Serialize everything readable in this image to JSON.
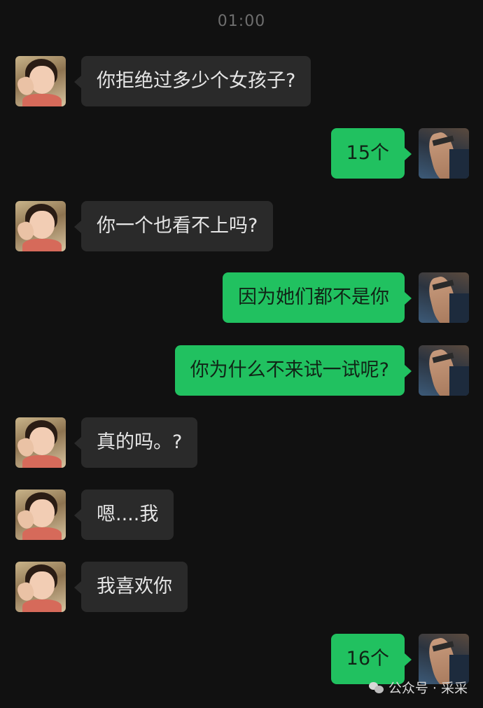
{
  "chat": {
    "timestamp": "01:00",
    "messages": [
      {
        "side": "left",
        "text": "你拒绝过多少个女孩子?"
      },
      {
        "side": "right",
        "text": "15个"
      },
      {
        "side": "left",
        "text": "你一个也看不上吗?"
      },
      {
        "side": "right",
        "text": "因为她们都不是你"
      },
      {
        "side": "right",
        "text": "你为什么不来试一试呢?"
      },
      {
        "side": "left",
        "text": "真的吗。?"
      },
      {
        "side": "left",
        "text": "嗯....我"
      },
      {
        "side": "left",
        "text": "我喜欢你"
      },
      {
        "side": "right",
        "text": "16个"
      }
    ]
  },
  "watermark": {
    "text": "公众号 · 采采",
    "icon": "wechat-official-account-icon"
  },
  "colors": {
    "background": "#111111",
    "incoming_bubble": "#2a2a2a",
    "outgoing_bubble": "#21c160"
  }
}
